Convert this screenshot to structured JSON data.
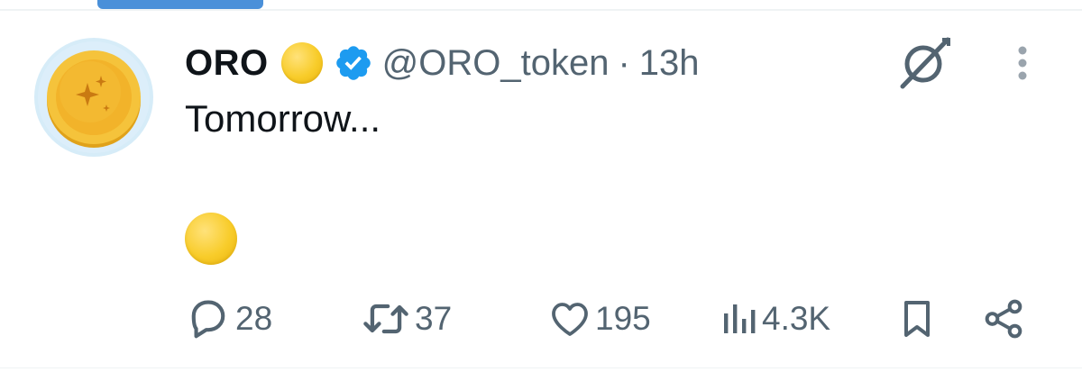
{
  "tweet": {
    "display_name": "ORO",
    "name_emoji": "yellow-circle",
    "verified": true,
    "handle": "@ORO_token",
    "separator": "·",
    "time": "13h",
    "text": "Tomorrow...",
    "body_emoji": "yellow-circle"
  },
  "actions": {
    "replies": "28",
    "reposts": "37",
    "likes": "195",
    "views": "4.3K"
  },
  "icons": {
    "avatar": "gold-coin-sparkles",
    "grok": "grok-icon",
    "more": "more-vertical-icon",
    "reply": "reply-bubble-icon",
    "repost": "repost-icon",
    "like": "heart-icon",
    "views": "analytics-icon",
    "bookmark": "bookmark-icon",
    "share": "share-icon"
  },
  "colors": {
    "text_primary": "#0f1419",
    "text_secondary": "#536471",
    "verified_blue": "#1d9bf0",
    "coin_gold": "#f5c33b",
    "tab_indicator": "#4a90d9"
  }
}
